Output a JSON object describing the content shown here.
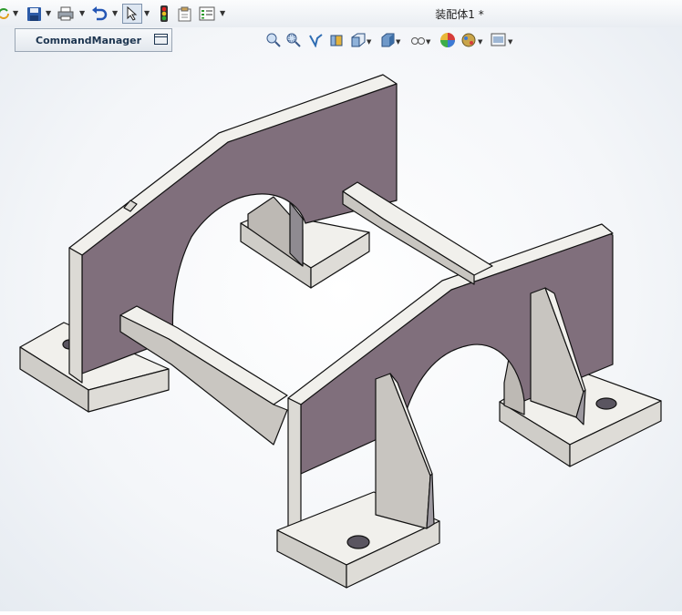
{
  "window": {
    "title": "装配体1 *"
  },
  "toolbar": {
    "items": [
      {
        "name": "rebuild-icon"
      },
      {
        "name": "save-icon"
      },
      {
        "name": "print-icon"
      },
      {
        "name": "undo-icon"
      },
      {
        "name": "select-icon"
      },
      {
        "name": "traffic-light-icon"
      },
      {
        "name": "file-properties-icon"
      },
      {
        "name": "options-icon"
      }
    ]
  },
  "command_manager": {
    "label": "CommandManager"
  },
  "heads_up_view": {
    "items": [
      "zoom-to-fit-icon",
      "zoom-to-area-icon",
      "previous-view-icon",
      "section-view-icon",
      "view-orientation-icon",
      "display-style-icon",
      "hide-show-icon",
      "edit-appearance-icon",
      "apply-scene-icon",
      "view-settings-icon"
    ]
  },
  "colors": {
    "part_face_dark": "#806f7c",
    "part_face_light": "#f1f0ec",
    "edge": "#111111"
  }
}
